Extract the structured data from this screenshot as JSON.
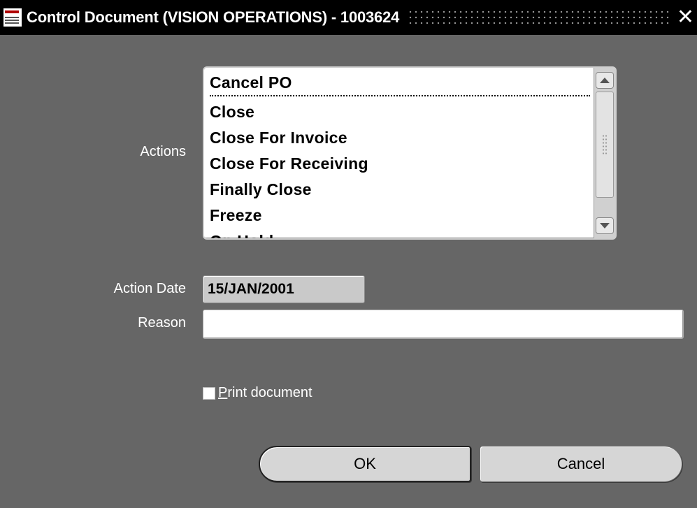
{
  "window": {
    "title": "Control Document (VISION OPERATIONS) - 1003624",
    "close_glyph": "✕",
    "icon": "oracle-applications-icon"
  },
  "actions": {
    "label": "Actions",
    "items": [
      {
        "label": "Cancel PO",
        "selected": true
      },
      {
        "label": "Close"
      },
      {
        "label": "Close For Invoice"
      },
      {
        "label": "Close For Receiving"
      },
      {
        "label": "Finally Close"
      },
      {
        "label": "Freeze"
      },
      {
        "label": "On Hold"
      }
    ]
  },
  "action_date": {
    "label": "Action Date",
    "value": "15/JAN/2001"
  },
  "reason": {
    "label": "Reason",
    "value": ""
  },
  "print_document": {
    "label_prefix": "P",
    "label_rest": "rint document",
    "checked": false
  },
  "buttons": {
    "ok": "OK",
    "cancel": "Cancel"
  },
  "colors": {
    "background": "#666666",
    "titlebar": "#000000",
    "button": "#d6d6d6"
  }
}
